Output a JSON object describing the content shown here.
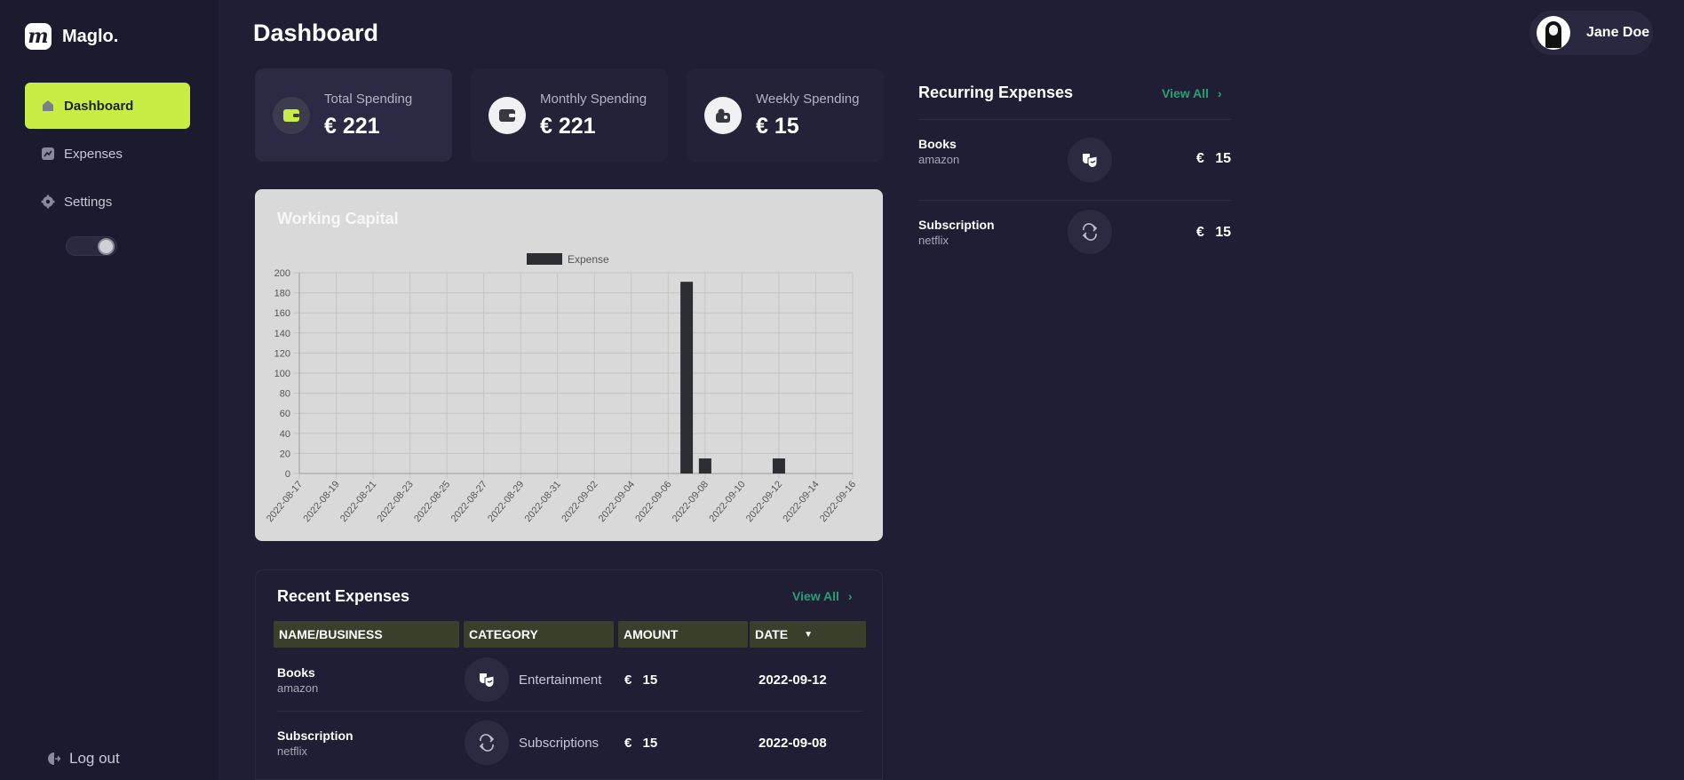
{
  "app": {
    "name": "Maglo."
  },
  "sidebar": {
    "items": [
      {
        "label": "Dashboard",
        "icon": "home-icon",
        "active": true
      },
      {
        "label": "Expenses",
        "icon": "chart-icon",
        "active": false
      },
      {
        "label": "Settings",
        "icon": "gear-icon",
        "active": false
      }
    ],
    "theme_toggle": {
      "icon": "theme-toggle"
    },
    "logout_label": "Log out"
  },
  "header": {
    "title": "Dashboard"
  },
  "user": {
    "name": "Jane Doe"
  },
  "stats": [
    {
      "label": "Total Spending",
      "value": "€ 221",
      "icon": "wallet-icon"
    },
    {
      "label": "Monthly Spending",
      "value": "€ 221",
      "icon": "wallet-icon"
    },
    {
      "label": "Weekly Spending",
      "value": "€ 15",
      "icon": "wallet-coins-icon"
    }
  ],
  "chart_data": {
    "type": "bar",
    "title": "Working Capital",
    "legend": [
      "Expense"
    ],
    "legend_position": "top",
    "grid": true,
    "ylim": [
      0,
      200
    ],
    "yticks": [
      0,
      20,
      40,
      60,
      80,
      100,
      120,
      140,
      160,
      180,
      200
    ],
    "xtick_labels": [
      "2022-08-17",
      "2022-08-19",
      "2022-08-21",
      "2022-08-23",
      "2022-08-25",
      "2022-08-27",
      "2022-08-29",
      "2022-08-31",
      "2022-09-02",
      "2022-09-04",
      "2022-09-06",
      "2022-09-08",
      "2022-09-10",
      "2022-09-12",
      "2022-09-14",
      "2022-09-16"
    ],
    "categories": [
      "2022-08-17",
      "2022-08-18",
      "2022-08-19",
      "2022-08-20",
      "2022-08-21",
      "2022-08-22",
      "2022-08-23",
      "2022-08-24",
      "2022-08-25",
      "2022-08-26",
      "2022-08-27",
      "2022-08-28",
      "2022-08-29",
      "2022-08-30",
      "2022-08-31",
      "2022-09-01",
      "2022-09-02",
      "2022-09-03",
      "2022-09-04",
      "2022-09-05",
      "2022-09-06",
      "2022-09-07",
      "2022-09-08",
      "2022-09-09",
      "2022-09-10",
      "2022-09-11",
      "2022-09-12",
      "2022-09-13",
      "2022-09-14",
      "2022-09-15",
      "2022-09-16"
    ],
    "series": [
      {
        "name": "Expense",
        "values": [
          0,
          0,
          0,
          0,
          0,
          0,
          0,
          0,
          0,
          0,
          0,
          0,
          0,
          0,
          0,
          0,
          0,
          0,
          0,
          0,
          0,
          191,
          15,
          0,
          0,
          0,
          15,
          0,
          0,
          0,
          0
        ]
      }
    ],
    "bar_color": "#2d2e33"
  },
  "recent": {
    "title": "Recent Expenses",
    "view_all": "View All",
    "columns": [
      "NAME/BUSINESS",
      "CATEGORY",
      "AMOUNT",
      "DATE"
    ],
    "rows": [
      {
        "name": "Books",
        "business": "amazon",
        "category": "Entertainment",
        "category_icon": "theater-mask-icon",
        "currency": "€",
        "amount": "15",
        "date": "2022-09-12"
      },
      {
        "name": "Subscription",
        "business": "netflix",
        "category": "Subscriptions",
        "category_icon": "repeat-icon",
        "currency": "€",
        "amount": "15",
        "date": "2022-09-08"
      }
    ]
  },
  "recurring": {
    "title": "Recurring Expenses",
    "view_all": "View All",
    "items": [
      {
        "name": "Books",
        "business": "amazon",
        "icon": "theater-mask-icon",
        "currency": "€",
        "amount": "15"
      },
      {
        "name": "Subscription",
        "business": "netflix",
        "icon": "repeat-icon",
        "currency": "€",
        "amount": "15"
      }
    ]
  },
  "colors": {
    "accent": "#c8ee44",
    "link": "#29a073",
    "background": "#201e34"
  }
}
